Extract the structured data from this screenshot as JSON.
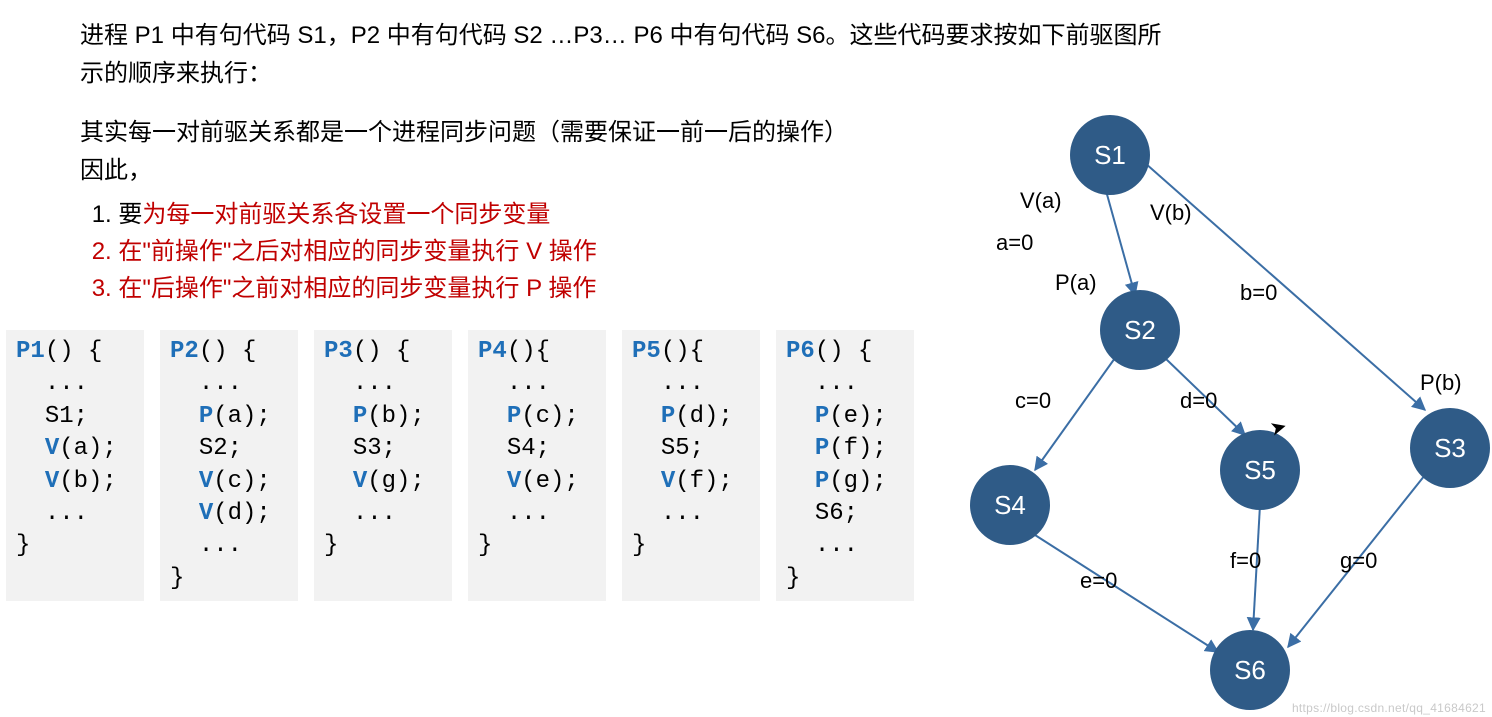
{
  "intro": {
    "line1": "进程 P1 中有句代码 S1，P2 中有句代码 S2 …P3… P6 中有句代码 S6。这些代码要求按如下前驱图所",
    "line2": "示的顺序来执行：",
    "line3": "其实每一对前驱关系都是一个进程同步问题（需要保证一前一后的操作）",
    "line4": "因此，",
    "li1_black": "要",
    "li1_red": "为每一对前驱关系各设置一个同步变量",
    "li2": "在\"前操作\"之后对相应的同步变量执行 V 操作",
    "li3": "在\"后操作\"之前对相应的同步变量执行 P 操作"
  },
  "code": {
    "p1_fn": "P1",
    "p1_l1": "() {",
    "p1_l2": "...",
    "p1_l3": "S1;",
    "p1_op1": "V",
    "p1_l4": "(a);",
    "p1_op2": "V",
    "p1_l5": "(b);",
    "p1_l6": "...",
    "p1_l7": "}",
    "p2_fn": "P2",
    "p2_l1": "() {",
    "p2_l2": "...",
    "p2_op1": "P",
    "p2_l3": "(a);",
    "p2_l4": "S2;",
    "p2_op2": "V",
    "p2_l5": "(c);",
    "p2_op3": "V",
    "p2_l6": "(d);",
    "p2_l7": "...",
    "p2_l8": "}",
    "p3_fn": "P3",
    "p3_l1": "() {",
    "p3_l2": "...",
    "p3_op1": "P",
    "p3_l3": "(b);",
    "p3_l4": "S3;",
    "p3_op2": "V",
    "p3_l5": "(g);",
    "p3_l6": "...",
    "p3_l7": "}",
    "p4_fn": "P4",
    "p4_l1": "(){",
    "p4_l2": "...",
    "p4_op1": "P",
    "p4_l3": "(c);",
    "p4_l4": "S4;",
    "p4_op2": "V",
    "p4_l5": "(e);",
    "p4_l6": "...",
    "p4_l7": "}",
    "p5_fn": "P5",
    "p5_l1": "(){",
    "p5_l2": "...",
    "p5_op1": "P",
    "p5_l3": "(d);",
    "p5_l4": "S5;",
    "p5_op2": "V",
    "p5_l5": "(f);",
    "p5_l6": "...",
    "p5_l7": "}",
    "p6_fn": "P6",
    "p6_l1": "() {",
    "p6_l2": "...",
    "p6_op1": "P",
    "p6_l3": "(e);",
    "p6_op2": "P",
    "p6_l4": "(f);",
    "p6_op3": "P",
    "p6_l5": "(g);",
    "p6_l6": "S6;",
    "p6_l7": "...",
    "p6_l8": "}"
  },
  "graph": {
    "nodes": {
      "s1": "S1",
      "s2": "S2",
      "s3": "S3",
      "s4": "S4",
      "s5": "S5",
      "s6": "S6"
    },
    "labels": {
      "va": "V(a)",
      "vb": "V(b)",
      "a0": "a=0",
      "pa": "P(a)",
      "b0": "b=0",
      "pb": "P(b)",
      "c0": "c=0",
      "d0": "d=0",
      "f0": "f=0",
      "g0": "g=0",
      "e0": "e=0"
    }
  },
  "watermark": "https://blog.csdn.net/qq_41684621"
}
